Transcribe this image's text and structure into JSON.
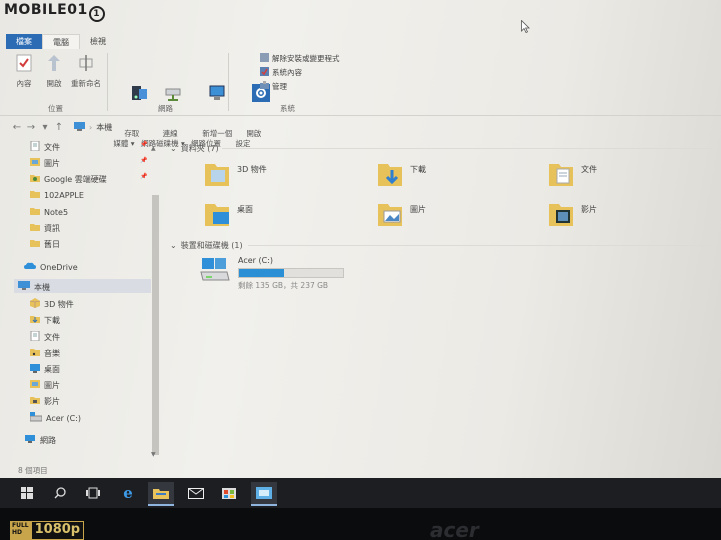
{
  "watermark": {
    "text": "MOBILE01"
  },
  "window": {
    "title": "本機"
  },
  "ribbon": {
    "tabs": [
      {
        "label": "檔案"
      },
      {
        "label": "電腦"
      },
      {
        "label": "檢視"
      }
    ],
    "location_group": {
      "label": "位置",
      "buttons": [
        {
          "label": "內容"
        },
        {
          "label": "開啟"
        },
        {
          "label": "重新命名"
        }
      ]
    },
    "network_group": {
      "label": "網路",
      "buttons": [
        {
          "label": "存取\n媒體 ▾"
        },
        {
          "label": "連線\n網路磁碟機 ▾"
        },
        {
          "label": "新增一個\n網路位置"
        }
      ]
    },
    "system_group": {
      "label": "系統",
      "open_settings": "開啟\n設定",
      "commands": [
        {
          "label": "解除安裝或變更程式"
        },
        {
          "label": "系統內容"
        },
        {
          "label": "管理"
        }
      ]
    }
  },
  "address": {
    "path": "本機"
  },
  "sidebar": {
    "items": [
      {
        "label": "文件",
        "pinned": true
      },
      {
        "label": "圖片",
        "pinned": true
      },
      {
        "label": "Google 雲端硬碟",
        "pinned": true
      },
      {
        "label": "102APPLE"
      },
      {
        "label": "Note5"
      },
      {
        "label": "資訊"
      },
      {
        "label": "舊日"
      },
      {
        "label": "OneDrive"
      },
      {
        "label": "本機"
      },
      {
        "label": "3D 物件"
      },
      {
        "label": "下載"
      },
      {
        "label": "文件"
      },
      {
        "label": "音樂"
      },
      {
        "label": "桌面"
      },
      {
        "label": "圖片"
      },
      {
        "label": "影片"
      },
      {
        "label": "Acer (C:)"
      },
      {
        "label": "網路"
      }
    ]
  },
  "folders_section": {
    "label": "資料夾 (7)"
  },
  "folders": [
    {
      "label": "3D 物件"
    },
    {
      "label": "下載"
    },
    {
      "label": "文件"
    },
    {
      "label": "桌面"
    },
    {
      "label": "圖片"
    },
    {
      "label": "影片"
    }
  ],
  "devices_section": {
    "label": "裝置和磁碟機 (1)"
  },
  "drive": {
    "label": "Acer (C:)",
    "free_text": "剩餘 135 GB，共 237 GB",
    "used_fraction": 0.43
  },
  "status": {
    "text": "8 個項目"
  },
  "sticker": {
    "a": "FULL\nHD",
    "b": "1080p"
  },
  "brand": {
    "text": "acer"
  }
}
